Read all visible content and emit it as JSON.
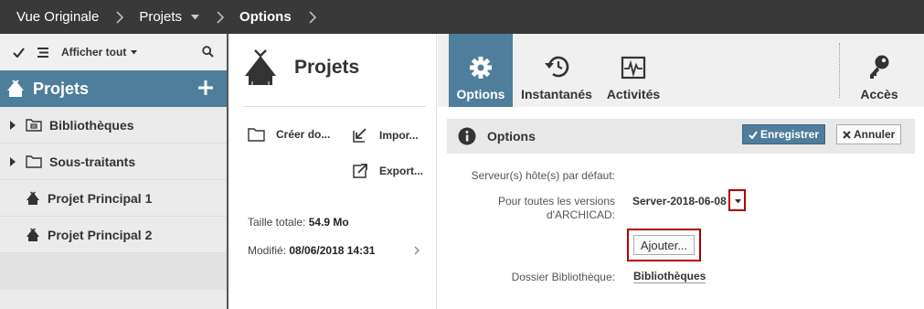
{
  "breadcrumb": {
    "items": [
      {
        "label": "Vue Originale",
        "current": false,
        "dropdown": false
      },
      {
        "label": "Projets",
        "current": false,
        "dropdown": true
      },
      {
        "label": "Options",
        "current": true,
        "dropdown": false
      }
    ],
    "separator_icon": "chevron-right-icon"
  },
  "left_panel": {
    "toolbar": {
      "check_icon": "checkmark-icon",
      "list_icon": "list-icon",
      "filter_label": "Afficher tout",
      "search_icon": "search-icon"
    },
    "header": {
      "title": "Projets",
      "icon": "project-hut-icon",
      "add_icon": "plus-icon"
    },
    "items": [
      {
        "label": "Bibliothèques",
        "icon": "library-folder-icon",
        "expandable": true
      },
      {
        "label": "Sous-traitants",
        "icon": "folder-icon",
        "expandable": true
      },
      {
        "label": "Projet Principal 1",
        "icon": "project-hut-icon",
        "expandable": false
      },
      {
        "label": "Projet Principal 2",
        "icon": "project-hut-icon",
        "expandable": false
      }
    ]
  },
  "middle_panel": {
    "title": "Projets",
    "actions": {
      "create_folder": "Créer do...",
      "import": "Impor...",
      "export": "Export..."
    },
    "total_size_label": "Taille totale:",
    "total_size_value": "54.9 Mo",
    "modified_label": "Modifié:",
    "modified_value": "08/06/2018 14:31"
  },
  "tabs": [
    {
      "label": "Options",
      "icon": "gear-icon",
      "active": true
    },
    {
      "label": "Instantanés",
      "icon": "snapshot-restore-icon",
      "active": false
    },
    {
      "label": "Activités",
      "icon": "activity-monitor-icon",
      "active": false
    },
    {
      "label": "Accès",
      "icon": "key-icon",
      "active": false
    }
  ],
  "options_panel": {
    "title": "Options",
    "info_icon": "info-icon",
    "save_label": "Enregistrer",
    "cancel_label": "Annuler",
    "default_hosts_label": "Serveur(s) hôte(s) par défaut:",
    "all_versions_label_line1": "Pour toutes les versions",
    "all_versions_label_line2": "d'ARCHICAD:",
    "server_value": "Server-2018-06-08",
    "add_label": "Ajouter...",
    "library_folder_label": "Dossier Bibliothèque:",
    "library_folder_value": "Bibliothèques"
  },
  "colors": {
    "topbar": "#393939",
    "accent": "#4e7e9b",
    "highlight_frame": "#b00000",
    "panel_bg": "#ebebeb"
  }
}
